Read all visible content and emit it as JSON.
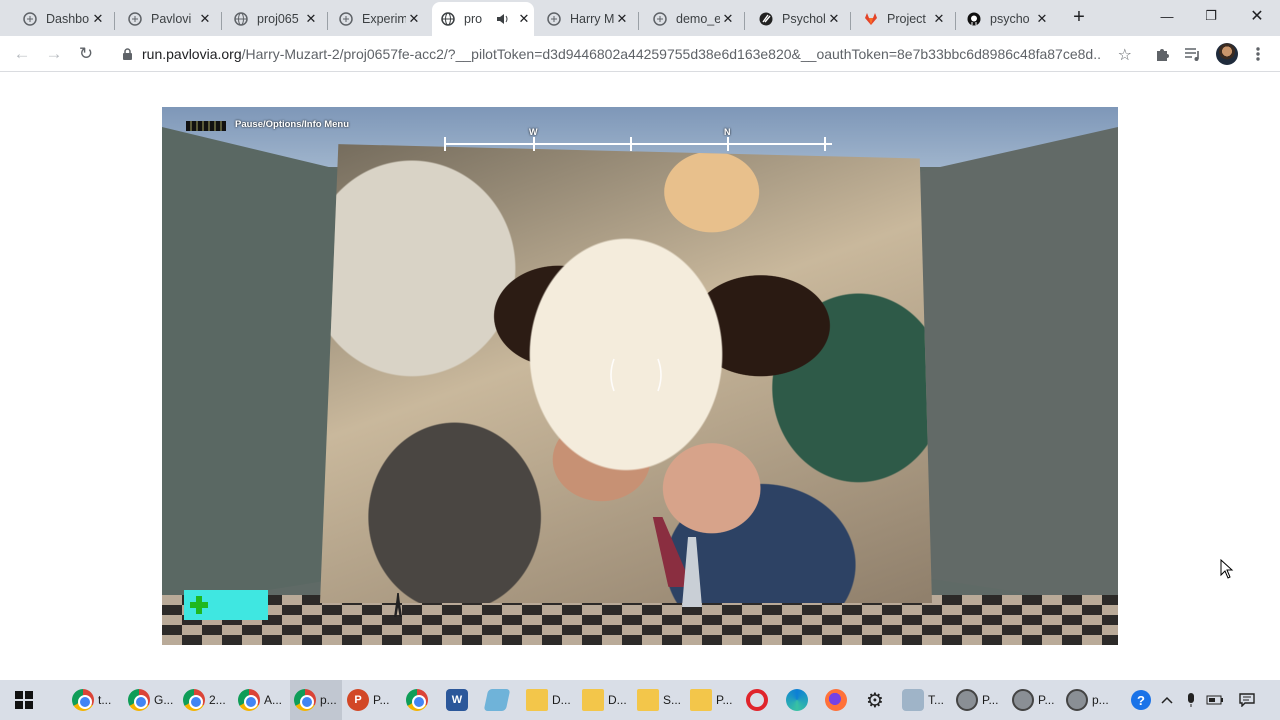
{
  "browser": {
    "tabs": [
      {
        "title": "Dashbo",
        "icon": "pavlovia-icon",
        "active": false
      },
      {
        "title": "Pavlovi",
        "icon": "pavlovia-icon",
        "active": false
      },
      {
        "title": "proj065",
        "icon": "globe-icon",
        "active": false
      },
      {
        "title": "Experim",
        "icon": "pavlovia-icon",
        "active": false
      },
      {
        "title": "pro",
        "icon": "globe-icon",
        "active": true,
        "audio": "speaker-icon"
      },
      {
        "title": "Harry M",
        "icon": "pavlovia-icon",
        "active": false
      },
      {
        "title": "demo_e",
        "icon": "pavlovia-icon",
        "active": false
      },
      {
        "title": "Psychol",
        "icon": "psychology-icon",
        "active": false
      },
      {
        "title": "Project",
        "icon": "gitlab-icon",
        "active": false
      },
      {
        "title": "psycho",
        "icon": "github-icon",
        "active": false
      }
    ],
    "close_glyph": "✕",
    "new_tab_glyph": "+",
    "window_controls": {
      "minimize": "—",
      "restore": "❐",
      "close": "✕"
    },
    "nav": {
      "back": "←",
      "forward": "→",
      "reload": "↻"
    },
    "address": {
      "host": "run.pavlovia.org",
      "path": "/Harry-Muzart-2/proj0657fe-acc2/?__pilotToken=d3d9446802a44259755d38e6d163e820&__oauthToken=8e7b33bbc6d8986c48fa87ce8d...",
      "bookmark_glyph": "☆"
    },
    "toolbar_icons": [
      "extensions-icon",
      "media-control-icon",
      "profile-avatar",
      "menu-icon"
    ]
  },
  "game": {
    "hud_menu_label": "Pause/Options/Info Menu",
    "compass": {
      "letters": [
        {
          "label": "W",
          "pos": 0.23
        },
        {
          "label": "N",
          "pos": 0.73
        }
      ],
      "ticks": [
        0.0,
        0.23,
        0.48,
        0.73,
        0.98
      ]
    },
    "health_icon": "plus-icon"
  },
  "taskbar": {
    "start_icon": "windows-start-icon",
    "items": [
      {
        "label": "t...",
        "icon": "chrome-icon"
      },
      {
        "label": "G...",
        "icon": "chrome-icon"
      },
      {
        "label": "2...",
        "icon": "chrome-icon"
      },
      {
        "label": "A...",
        "icon": "chrome-icon"
      },
      {
        "label": "p...",
        "icon": "chrome-icon",
        "active": true
      },
      {
        "label": "P...",
        "icon": "powerpoint-icon"
      },
      {
        "label": "",
        "icon": "chrome-icon"
      },
      {
        "label": "",
        "icon": "word-icon"
      },
      {
        "label": "",
        "icon": "notes-icon"
      },
      {
        "label": "D...",
        "icon": "folder-icon"
      },
      {
        "label": "D...",
        "icon": "folder-icon"
      },
      {
        "label": "S...",
        "icon": "folder-icon"
      },
      {
        "label": "P...",
        "icon": "folder-icon"
      },
      {
        "label": "",
        "icon": "opera-icon"
      },
      {
        "label": "",
        "icon": "edge-icon"
      },
      {
        "label": "",
        "icon": "firefox-icon"
      },
      {
        "label": "",
        "icon": "settings-icon"
      },
      {
        "label": "T...",
        "icon": "app-icon"
      },
      {
        "label": "P...",
        "icon": "psychopy-icon"
      },
      {
        "label": "P...",
        "icon": "psychopy-icon"
      },
      {
        "label": "p...",
        "icon": "psychopy-icon"
      }
    ],
    "tray": [
      "help-icon",
      "chevron-up-icon",
      "microphone-icon",
      "battery-icon",
      "notification-icon"
    ]
  }
}
